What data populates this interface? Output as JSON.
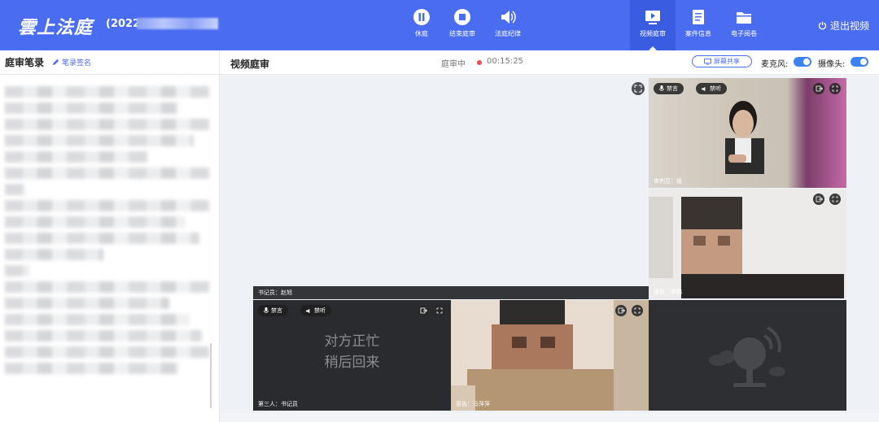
{
  "app": {
    "logo": "雲上法庭",
    "case_number": "(2022"
  },
  "toolbar": {
    "pause": "休庭",
    "end": "结束庭审",
    "discipline": "法庭纪律",
    "video_trial": "视频庭审",
    "case_info": "案件信息",
    "e_files": "电子阅卷",
    "exit": "退出视频"
  },
  "left_panel": {
    "title": "庭审笔录",
    "sign_link": "笔录签名"
  },
  "main": {
    "title": "视频庭审",
    "status": "庭审中",
    "timer": "00:15:25",
    "share": "屏幕共享",
    "mic_label": "麦克风:",
    "camera_label": "摄像头:",
    "mic_on": true,
    "camera_on": true
  },
  "tiles": {
    "judge": {
      "role": "审判员：徐",
      "mute": "禁言",
      "deafen": "禁听"
    },
    "defendant": {
      "role": "被告：李鹏"
    },
    "clerk_bar": {
      "role": "书记员：赵旭"
    },
    "third": {
      "role": "第三人：书记员",
      "mute": "禁言",
      "deafen": "禁听",
      "busy_line1": "对方正忙",
      "busy_line2": "稍后回来"
    },
    "plaintiff": {
      "role": "原告：马萍萍"
    }
  },
  "colors": {
    "topbar": "#4a6cf0",
    "accent": "#3b82f6",
    "rec": "#f04a4a"
  }
}
